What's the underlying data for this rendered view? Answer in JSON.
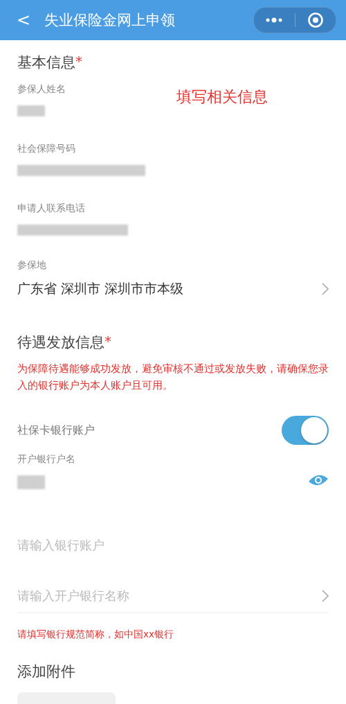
{
  "nav_bar": {
    "back": "<",
    "title": "失业保险金网上申领"
  },
  "annotation": "填写相关信息",
  "basic_info": {
    "title": "基本信息",
    "required_mark": "*",
    "fields": [
      {
        "kind": "redacted",
        "label": "参保人姓名"
      },
      {
        "kind": "redacted",
        "label": "社会保障号码"
      },
      {
        "kind": "redacted",
        "label": "申请人联系电话"
      },
      {
        "kind": "select",
        "label": "参保地",
        "value": "广东省 深圳市 深圳市市本级"
      }
    ]
  },
  "payment_info": {
    "title": "待遇发放信息",
    "required_mark": "*",
    "notice": "为保障待遇能够成功发放，避免审核不通过或发放失败，请确保您录入的银行账户为本人账户且可用。",
    "toggle": {
      "label": "社保卡银行账户",
      "on": true
    },
    "fields": [
      {
        "kind": "redacted_eye",
        "label": "开户银行户名"
      },
      {
        "kind": "input",
        "placeholder": "请输入银行账户"
      },
      {
        "kind": "select_input",
        "placeholder": "请输入开户银行名称"
      }
    ],
    "hint": "请填写银行规范简称，如中国xx银行"
  },
  "attachments": {
    "title": "添加附件"
  }
}
